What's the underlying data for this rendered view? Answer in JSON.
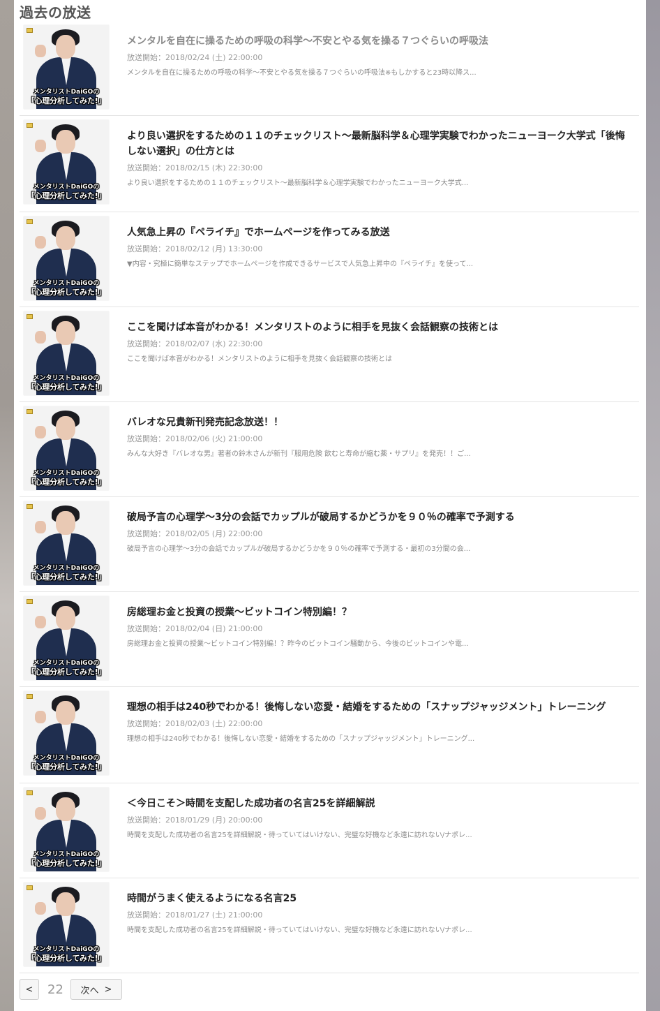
{
  "section": {
    "heading": "過去の放送"
  },
  "thumbnail": {
    "line1": "メンタリストDaiGOの",
    "line2": "「心理分析してみた!」"
  },
  "items": [
    {
      "title": "メンタルを自在に操るための呼吸の科学〜不安とやる気を操る７つぐらいの呼吸法",
      "dim": true,
      "meta": "放送開始：2018/02/24 (土) 22:00:00",
      "desc": "メンタルを自在に操るための呼吸の科学〜不安とやる気を操る７つぐらいの呼吸法※もしかすると23時以降ス..."
    },
    {
      "title": "より良い選択をするための１１のチェックリスト〜最新脳科学＆心理学実験でわかったニューヨーク大学式「後悔しない選択」の仕方とは",
      "dim": false,
      "meta": "放送開始：2018/02/15 (木) 22:30:00",
      "desc": "より良い選択をするための１１のチェックリスト〜最新脳科学＆心理学実験でわかったニューヨーク大学式..."
    },
    {
      "title": "人気急上昇の『ペライチ』でホームページを作ってみる放送",
      "dim": false,
      "meta": "放送開始：2018/02/12 (月) 13:30:00",
      "desc": "▼内容・究極に簡単なステップでホームページを作成できるサービスで人気急上昇中の『ペライチ』を使って..."
    },
    {
      "title": "ここを聞けば本音がわかる！メンタリストのように相手を見抜く会話観察の技術とは",
      "dim": false,
      "meta": "放送開始：2018/02/07 (水) 22:30:00",
      "desc": "ここを聞けば本音がわかる！メンタリストのように相手を見抜く会話観察の技術とは"
    },
    {
      "title": "バレオな兄貴新刊発売記念放送！！",
      "dim": false,
      "meta": "放送開始：2018/02/06 (火) 21:00:00",
      "desc": "みんな大好き『バレオな男』著者の鈴木さんが新刊『服用危険 飲むと寿命が縮む薬・サプリ』を発売！！ご..."
    },
    {
      "title": "破局予言の心理学〜3分の会話でカップルが破局するかどうかを９０％の確率で予測する",
      "dim": false,
      "meta": "放送開始：2018/02/05 (月) 22:00:00",
      "desc": "破局予言の心理学〜3分の会話でカップルが破局するかどうかを９０％の確率で予測する・最初の3分間の会..."
    },
    {
      "title": "房総理お金と投資の授業〜ビットコイン特別編！？",
      "dim": false,
      "meta": "放送開始：2018/02/04 (日) 21:00:00",
      "desc": "房総理お金と投資の授業〜ビットコイン特別編！？昨今のビットコイン騒動から、今後のビットコインや電..."
    },
    {
      "title": "理想の相手は240秒でわかる！後悔しない恋愛・結婚をするための「スナップジャッジメント」トレーニング",
      "dim": false,
      "meta": "放送開始：2018/02/03 (土) 22:00:00",
      "desc": "理想の相手は240秒でわかる！後悔しない恋愛・結婚をするための「スナップジャッジメント」トレーニング..."
    },
    {
      "title": "＜今日こそ＞時間を支配した成功者の名言25を詳細解説",
      "dim": false,
      "meta": "放送開始：2018/01/29 (月) 20:00:00",
      "desc": "時間を支配した成功者の名言25を詳細解説・待っていてはいけない、完璧な好機など永遠に訪れない/ナポレ..."
    },
    {
      "title": "時間がうまく使えるようになる名言25",
      "dim": false,
      "meta": "放送開始：2018/01/27 (土) 21:00:00",
      "desc": "時間を支配した成功者の名言25を詳細解説・待っていてはいけない、完璧な好機など永遠に訪れない/ナポレ..."
    }
  ],
  "pagination": {
    "prev": "<",
    "page": "22",
    "next_label": "次へ",
    "next_arrow": ">"
  }
}
